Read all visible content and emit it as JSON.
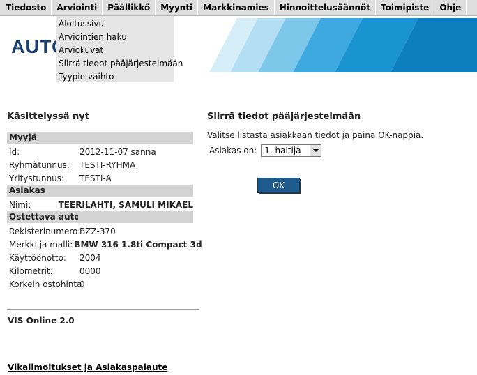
{
  "menu": {
    "items": [
      {
        "label": "Tiedosto"
      },
      {
        "label": "Arviointi"
      },
      {
        "label": "Päällikkö"
      },
      {
        "label": "Myynti"
      },
      {
        "label": "Markkinamies"
      },
      {
        "label": "Hinnoittelusäännöt"
      },
      {
        "label": "Toimipiste"
      },
      {
        "label": "Ohje"
      }
    ],
    "dropdown": [
      {
        "label": "Aloitussivu"
      },
      {
        "label": "Arviointien haku"
      },
      {
        "label": "Arviokuvat"
      },
      {
        "label": "Siirrä tiedot pääjärjestelmään"
      },
      {
        "label": "Tyypin vaihto"
      }
    ]
  },
  "logo": {
    "text": "AUTO"
  },
  "left": {
    "title": "Käsittelyssä nyt",
    "seller_header": "Myyjä",
    "seller": [
      {
        "key": "Id:",
        "value": "2012-11-07  sanna"
      },
      {
        "key": "Ryhmätunnus:",
        "value": "TESTI-RYHMA"
      },
      {
        "key": "Yritystunnus:",
        "value": "TESTI-A"
      }
    ],
    "customer_header": "Asiakas",
    "customer": [
      {
        "key": "Nimi:",
        "value": "TEERILAHTI, SAMULI MIKAEL"
      }
    ],
    "car_header": "Ostettava auto",
    "car": [
      {
        "key": "Rekisterinumero:",
        "value": "BZZ-370"
      },
      {
        "key": "Merkki ja malli:",
        "value": "BMW 316 1.8ti Compact 3d"
      },
      {
        "key": "Käyttöönotto:",
        "value": "2004"
      },
      {
        "key": "Kilometrit:",
        "value": "0000"
      },
      {
        "key": "Korkein ostohinta",
        "value": "0"
      }
    ],
    "version": "VIS Online 2.0",
    "feedback_link": "Vikailmoitukset ja Asiakaspalaute"
  },
  "right": {
    "title": "Siirrä tiedot pääjärjestelmään",
    "instruction": "Valitse listasta asiakkaan tiedot ja paina OK-nappia.",
    "customer_label": "Asiakas on:",
    "customer_selected": "1. haltija",
    "ok_label": "OK"
  },
  "colors": {
    "brand": "#1a3e6d",
    "button": "#1e5a8c",
    "menu_bg": "#dedede"
  }
}
